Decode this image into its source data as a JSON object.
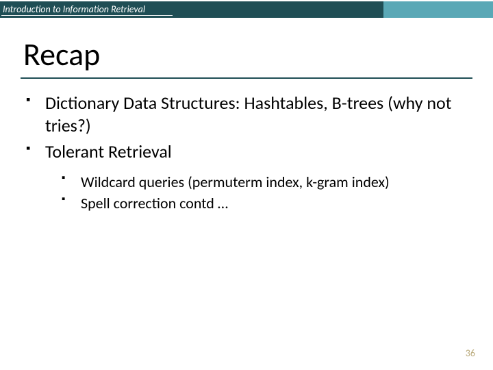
{
  "header": {
    "course": "Introduction to Information Retrieval"
  },
  "title": "Recap",
  "bullets": {
    "b1": "Dictionary Data Structures: Hashtables, B-trees (why not tries?)",
    "b2": "Tolerant Retrieval",
    "sub1": "Wildcard queries (permuterm index, k-gram index)",
    "sub2": "Spell correction contd …"
  },
  "page_number": "36"
}
